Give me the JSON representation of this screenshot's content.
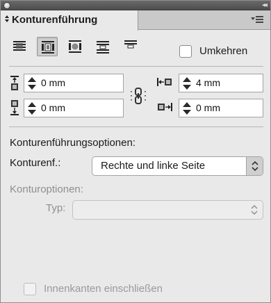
{
  "panel": {
    "tab_label": "Konturenführung",
    "collapse_glyph": "◂◂"
  },
  "wrap_modes": [
    {
      "name": "no-wrap",
      "active": false
    },
    {
      "name": "wrap-around-bounding-box",
      "active": true
    },
    {
      "name": "wrap-around-object-shape",
      "active": false
    },
    {
      "name": "jump-object",
      "active": false
    },
    {
      "name": "jump-to-next-column",
      "active": false
    }
  ],
  "invert": {
    "label": "Umkehren",
    "checked": false
  },
  "offsets": {
    "top": "0 mm",
    "bottom": "0 mm",
    "left": "4 mm",
    "right": "0 mm"
  },
  "wrap_options": {
    "heading": "Konturenführungsoptionen:",
    "wrap_to_label": "Konturenf.:",
    "wrap_to_value": "Rechte und linke Seite"
  },
  "contour_options": {
    "heading": "Konturoptionen:",
    "type_label": "Typ:",
    "type_value": ""
  },
  "include_inside_edges": {
    "label": "Innenkanten einschließen",
    "checked": false,
    "enabled": false
  }
}
